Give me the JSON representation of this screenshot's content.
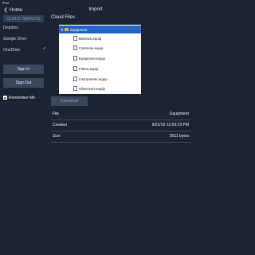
{
  "status_bar": {
    "device": "iPad",
    "time": "",
    "battery": ""
  },
  "nav": {
    "back_label": "Home",
    "title": "Import"
  },
  "sidebar": {
    "header": "CLOUD SERVICE",
    "providers": [
      {
        "label": "Dropbox",
        "selected": false
      },
      {
        "label": "Google Drive",
        "selected": false
      },
      {
        "label": "OneDrive",
        "selected": true
      }
    ],
    "sign_in_label": "Sign In",
    "sign_out_label": "Sign Out",
    "remember_me": {
      "label": "Remember Me",
      "checked": true
    },
    "check_glyph": "✓"
  },
  "main": {
    "title": "Cloud Files",
    "tree": {
      "root": "Equipment",
      "children": [
        "Barlows.equip",
        "Cameras.equip",
        "Eyepieces.equip",
        "Filters.equip",
        "Instruments.equip",
        "Observers.equip"
      ]
    },
    "download_label": "Download",
    "details": [
      {
        "label": "File",
        "value": "Equipment"
      },
      {
        "label": "Created",
        "value": "9/21/18 12:03:19 PM"
      },
      {
        "label": "Size",
        "value": "9911 bytes"
      }
    ]
  },
  "colors": {
    "background": "#1b2432",
    "selected_row": "#2565c7",
    "button": "#3a475c"
  }
}
